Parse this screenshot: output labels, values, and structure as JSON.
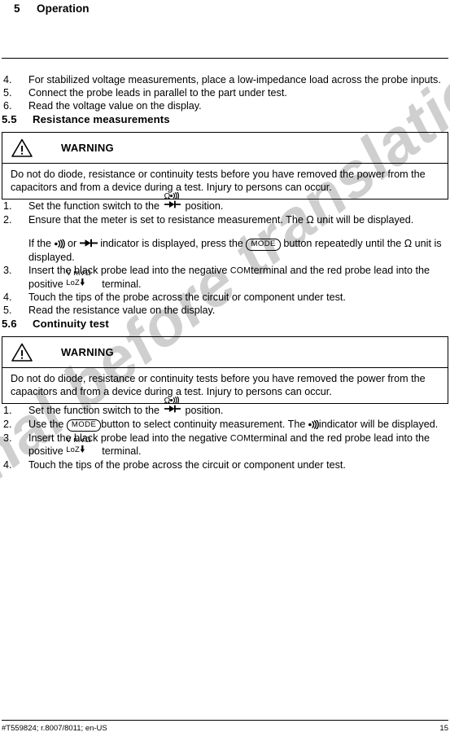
{
  "document": {
    "running_head": {
      "number": "5",
      "title": "Operation"
    },
    "footer": {
      "doc_id": "#T559824; r.8007/8011; en-US",
      "page_number": "15"
    },
    "watermark": "inal before translatio"
  },
  "continued_list": {
    "items": [
      {
        "marker": "4.",
        "text": "For stabilized voltage measurements, place a low-impedance load across the probe inputs."
      },
      {
        "marker": "5.",
        "text": "Connect the probe leads in parallel to the part under test."
      },
      {
        "marker": "6.",
        "text": "Read the voltage value on the display."
      }
    ]
  },
  "section_55": {
    "number": "5.5",
    "title": "Resistance measurements",
    "warning": {
      "label": "WARNING",
      "icon": "warning-triangle-icon",
      "text": "Do not do diode, resistance or continuity tests before you have removed the power from the capacitors and from a device during a test. Injury to persons can occur."
    },
    "steps": {
      "s1": {
        "marker": "1.",
        "before": "Set the function switch to the",
        "symbol_top": "Ω",
        "symbol_sound": "sound-icon",
        "symbol_diode": "diode-icon",
        "after": "position."
      },
      "s2": {
        "marker": "2.",
        "text": "Ensure that the meter is set to resistance measurement. The Ω unit will be displayed.",
        "note_a": "If the",
        "note_b": "or",
        "note_c": "indicator is displayed, press the",
        "mode_button": "MODE",
        "note_d": "button repeatedly until the Ω unit is displayed."
      },
      "s3": {
        "marker": "3.",
        "a": "Insert the black probe lead into the negative",
        "com": "COM",
        "b": "terminal and the red probe lead into the positive",
        "term_top": "V mVΩ",
        "term_bottom": "LoZ",
        "c": "terminal."
      },
      "s4": {
        "marker": "4.",
        "text": "Touch the tips of the probe across the circuit or component under test."
      },
      "s5": {
        "marker": "5.",
        "text": "Read the resistance value on the display."
      }
    }
  },
  "section_56": {
    "number": "5.6",
    "title": "Continuity test",
    "warning": {
      "label": "WARNING",
      "icon": "warning-triangle-icon",
      "text": "Do not do diode, resistance or continuity tests before you have removed the power from the capacitors and from a device during a test. Injury to persons can occur."
    },
    "steps": {
      "s1": {
        "marker": "1.",
        "before": "Set the function switch to the",
        "symbol_top": "Ω",
        "after": "position."
      },
      "s2": {
        "marker": "2.",
        "a": "Use the",
        "mode_button": "MODE",
        "b": "button to select continuity measurement. The",
        "c": "indicator will be displayed."
      },
      "s3": {
        "marker": "3.",
        "a": "Insert the black probe lead into the negative",
        "com": "COM",
        "b": "terminal and the red probe lead into the positive",
        "term_top": "V mVΩ",
        "term_bottom": "LoZ",
        "c": "terminal."
      },
      "s4": {
        "marker": "4.",
        "text": "Touch the tips of the probe across the circuit or component under test."
      }
    }
  }
}
